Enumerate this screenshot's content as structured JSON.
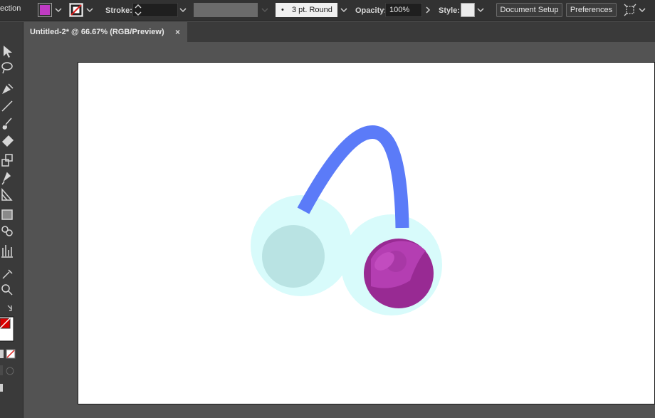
{
  "control_bar": {
    "selection_label": "ection",
    "fill_color": "#c03bc3",
    "stroke_label": "Stroke:",
    "stroke_weight": "",
    "brush_profile": "3 pt. Round",
    "brush_dot": "•",
    "opacity_label": "Opacity:",
    "opacity_value": "100%",
    "style_label": "Style:",
    "document_setup_label": "Document Setup",
    "preferences_label": "Preferences"
  },
  "document_tab": {
    "title": "Untitled-2* @ 66.67% (RGB/Preview)",
    "close_glyph": "×"
  },
  "toolbar": {
    "tools": [
      "selection-tool",
      "lasso-tool",
      "pen-tool",
      "line-tool",
      "paintbrush-tool",
      "eraser-tool",
      "scale-tool",
      "puppet-warp-tool",
      "perspective-grid-tool",
      "gradient-tool",
      "shape-builder-tool",
      "graph-tool",
      "eyedropper-tool",
      "zoom-tool"
    ]
  },
  "artwork": {
    "band_color": "#5b7bf8",
    "cup_outer_color": "#d8fbfb",
    "cup_inner_left_color": "#b9e3e3",
    "cup_inner_right_color": "#982a93",
    "cup_highlight_color": "#b43eb2"
  }
}
